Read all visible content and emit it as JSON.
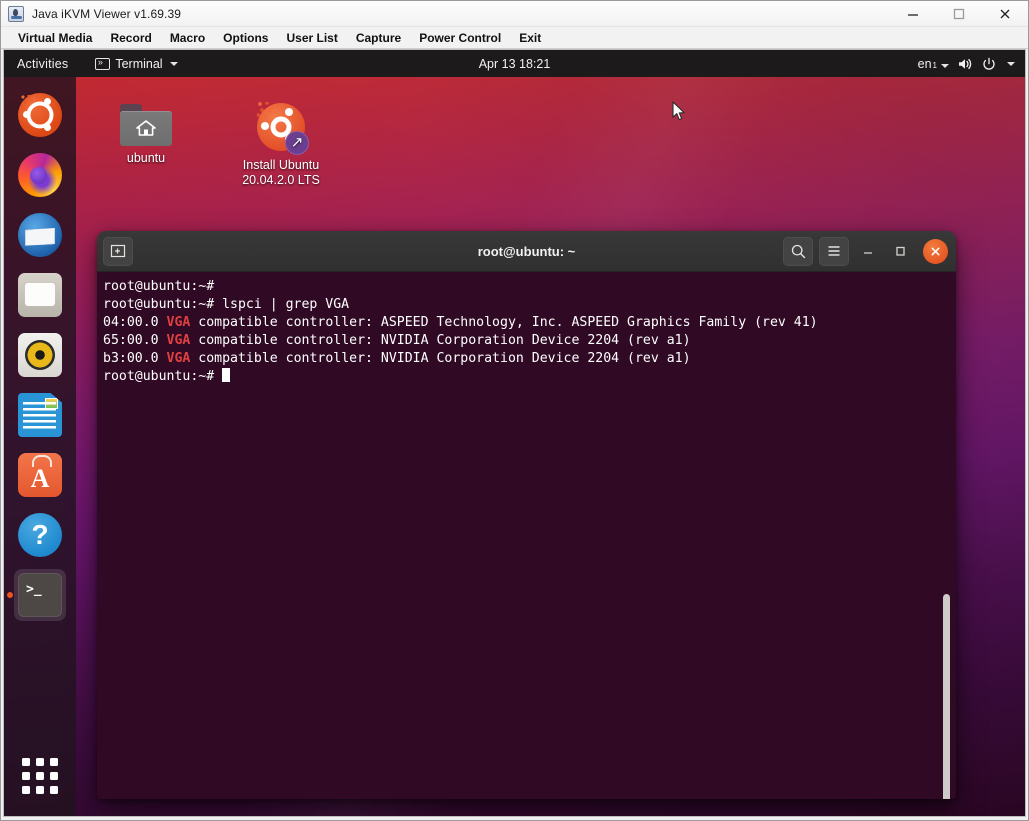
{
  "java_window": {
    "title": "Java iKVM Viewer v1.69.39",
    "app_icon": "java-coffee-cup-icon",
    "controls": {
      "minimize": "minimize-icon",
      "maximize": "maximize-icon",
      "close": "close-icon"
    },
    "menu": [
      "Virtual Media",
      "Record",
      "Macro",
      "Options",
      "User List",
      "Capture",
      "Power Control",
      "Exit"
    ]
  },
  "topbar": {
    "activities": "Activities",
    "app_name": "Terminal",
    "app_icon": "terminal-icon",
    "clock": "Apr 13  18:21",
    "keyboard_layout": "en",
    "keyboard_layout_sub": "1",
    "volume_icon": "volume-icon",
    "power_icon": "power-icon"
  },
  "dock": {
    "items": [
      {
        "name": "ubuntu-logo",
        "label": "Ubuntu"
      },
      {
        "name": "firefox",
        "label": "Firefox Web Browser"
      },
      {
        "name": "thunderbird",
        "label": "Thunderbird Mail"
      },
      {
        "name": "files",
        "label": "Files"
      },
      {
        "name": "rhythmbox",
        "label": "Rhythmbox"
      },
      {
        "name": "libreoffice-writer",
        "label": "LibreOffice Writer"
      },
      {
        "name": "ubuntu-software",
        "label": "Ubuntu Software"
      },
      {
        "name": "help",
        "label": "Help"
      },
      {
        "name": "terminal",
        "label": "Terminal",
        "running": true
      }
    ],
    "show_apps_label": "Show Applications"
  },
  "desktop_icons": [
    {
      "name": "home-folder",
      "label": "ubuntu"
    },
    {
      "name": "install-ubuntu",
      "label_line1": "Install Ubuntu",
      "label_line2": "20.04.2.0 LTS"
    }
  ],
  "terminal": {
    "title": "root@ubuntu: ~",
    "new_tab_icon": "new-tab-icon",
    "search_icon": "search-icon",
    "menu_icon": "hamburger-menu-icon",
    "minimize_icon": "minimize-icon",
    "maximize_icon": "maximize-icon",
    "close_icon": "close-icon",
    "lines": [
      {
        "prompt": "root@ubuntu:~# ",
        "command": ""
      },
      {
        "prompt": "root@ubuntu:~# ",
        "command": "lspci | grep VGA"
      },
      {
        "pre": "04:00.0 ",
        "hl": "VGA",
        "post": " compatible controller: ASPEED Technology, Inc. ASPEED Graphics Family (rev 41)"
      },
      {
        "pre": "65:00.0 ",
        "hl": "VGA",
        "post": " compatible controller: NVIDIA Corporation Device 2204 (rev a1)"
      },
      {
        "pre": "b3:00.0 ",
        "hl": "VGA",
        "post": " compatible controller: NVIDIA Corporation Device 2204 (rev a1)"
      },
      {
        "prompt": "root@ubuntu:~# ",
        "command": "",
        "cursor": true
      }
    ]
  },
  "colors": {
    "terminal_bg": "#300a24",
    "vga_highlight": "#e04040",
    "ubuntu_orange": "#e95420",
    "topbar_bg": "#1d1a1b"
  }
}
